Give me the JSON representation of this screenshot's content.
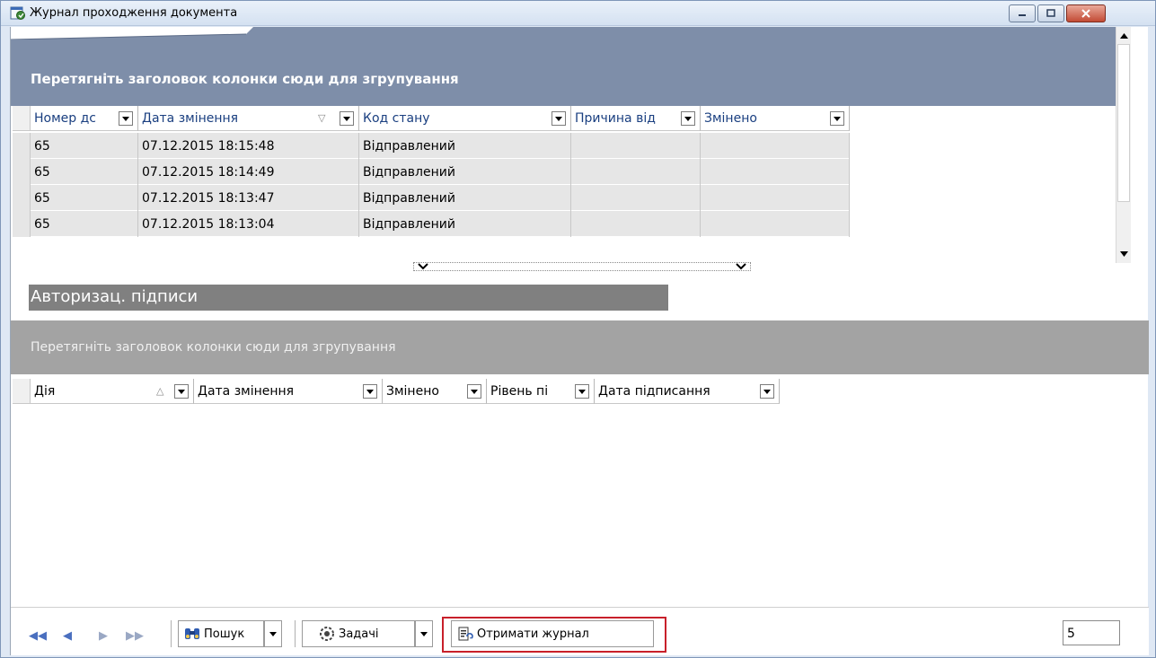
{
  "window": {
    "title": "Журнал проходження документа"
  },
  "upper": {
    "group_hint": "Перетягніть заголовок колонки сюди для згрупування",
    "columns": [
      "Номер дс",
      "Дата змінення",
      "Код стану",
      "Причина від",
      "Змінено"
    ],
    "rows": [
      {
        "number": "65",
        "date": "07.12.2015 18:15:48",
        "status": "Відправлений",
        "reason": "",
        "changed": ""
      },
      {
        "number": "65",
        "date": "07.12.2015 18:14:49",
        "status": "Відправлений",
        "reason": "",
        "changed": ""
      },
      {
        "number": "65",
        "date": "07.12.2015 18:13:47",
        "status": "Відправлений",
        "reason": "",
        "changed": ""
      },
      {
        "number": "65",
        "date": "07.12.2015 18:13:04",
        "status": "Відправлений",
        "reason": "",
        "changed": ""
      }
    ]
  },
  "signatures": {
    "caption": "Авторизац. підписи",
    "group_hint": "Перетягніть заголовок колонки сюди для згрупування",
    "columns": [
      "Дія",
      "Дата змінення",
      "Змінено",
      "Рівень пі",
      "Дата підписання"
    ]
  },
  "toolbar": {
    "nav_first": "◀◀",
    "nav_prev": "◀",
    "nav_next": "▶",
    "nav_last": "▶▶",
    "search_label": "Пошук",
    "tasks_label": "Задачі",
    "get_log_label": "Отримати журнал",
    "record_count": "5"
  },
  "icons": {
    "window": "window-doc-icon",
    "search": "binoculars-icon",
    "tasks": "tasks-gear-icon",
    "get_log": "journal-refresh-icon"
  },
  "colors": {
    "group_panel_upper": "#7e8ea9",
    "group_panel_lower": "#a3a3a3",
    "highlight": "#c8202a",
    "header_text": "#1a3f80"
  }
}
